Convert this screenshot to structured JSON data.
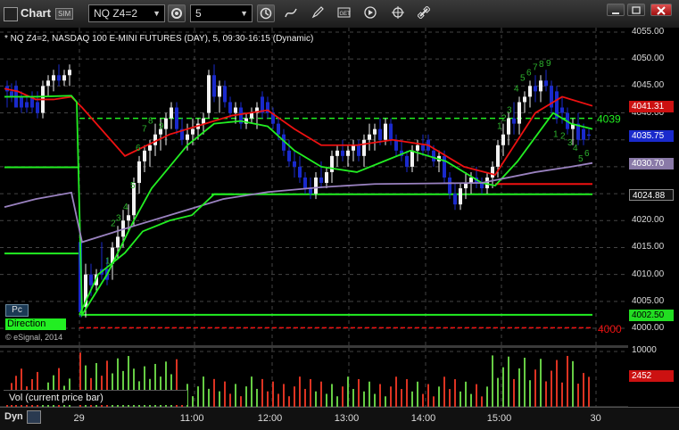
{
  "app": {
    "title": "Chart",
    "badge": "SIM"
  },
  "toolbar": {
    "symbol": "NQ Z4=2",
    "interval": "5"
  },
  "chart": {
    "header": "* NQ Z4=2, NASDAQ 100 E-MINI FUTURES (DAY), 5, 09:30-16:15 (Dynamic)",
    "copyright": "© eSignal, 2014",
    "pc_label": "Pc",
    "direction_label": "Direction",
    "level_4039": "4039",
    "level_4000": "4000"
  },
  "price_scale": {
    "labels": [
      "4055.00",
      "4050.00",
      "4045.00",
      "4040.00",
      "4035.00",
      "4030.00",
      "4025.00",
      "4020.00",
      "4015.00",
      "4010.00",
      "4005.00",
      "4000.00"
    ],
    "tags": [
      {
        "text": "4041.31",
        "bg": "#cc1111",
        "fg": "#ffffff",
        "value": 4041.31
      },
      {
        "text": "4035.75",
        "bg": "#1a2acc",
        "fg": "#ffffff",
        "value": 4035.75
      },
      {
        "text": "4030.70",
        "bg": "#8a7aa8",
        "fg": "#ffffff",
        "value": 4030.7
      },
      {
        "text": "4024.88",
        "bg": "#111111",
        "fg": "#ffffff",
        "value": 4024.88
      },
      {
        "text": "4002.50",
        "bg": "#22dd22",
        "fg": "#000000",
        "value": 4002.5
      }
    ]
  },
  "volume": {
    "label": "Vol (current price bar)",
    "scale_top": "10000",
    "tag": "2452"
  },
  "time_axis": {
    "dyn_label": "Dyn",
    "labels": [
      "29",
      "11:00",
      "12:00",
      "13:00",
      "14:00",
      "15:00",
      "30"
    ]
  },
  "colors": {
    "up_candle": "#f2f2f2",
    "down_candle": "#1a2acc",
    "red_ma": "#ee1111",
    "green_ma": "#22ee22",
    "purple_ma": "#9a82c0",
    "grid": "#444444"
  },
  "seq_counts": [
    "1",
    "2",
    "3",
    "4",
    "5",
    "6",
    "7",
    "8",
    "9",
    "1",
    "2",
    "3",
    "4",
    "5",
    "6",
    "7",
    "8",
    "9",
    "1",
    "2",
    "3",
    "4",
    "5",
    "6"
  ]
}
